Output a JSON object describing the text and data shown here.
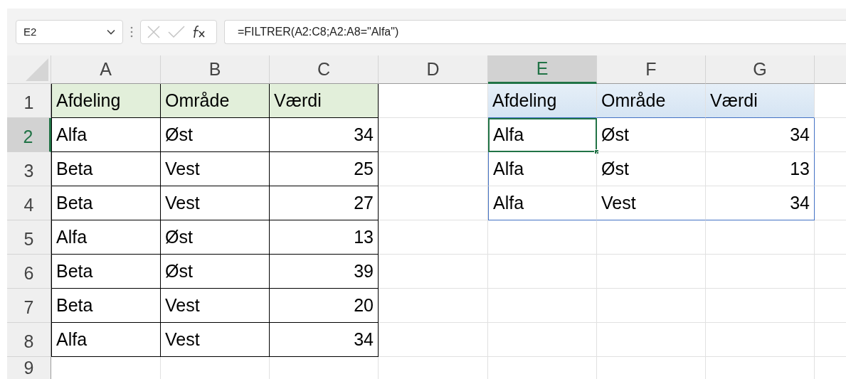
{
  "name_box": "E2",
  "formula": "=FILTRER(A2:C8;A2:A8=\"Alfa\")",
  "column_headers": [
    {
      "label": "A",
      "selected": false
    },
    {
      "label": "B",
      "selected": false
    },
    {
      "label": "C",
      "selected": false
    },
    {
      "label": "D",
      "selected": false
    },
    {
      "label": "E",
      "selected": true
    },
    {
      "label": "F",
      "selected": false
    },
    {
      "label": "G",
      "selected": false
    }
  ],
  "row_headers": [
    {
      "label": "1",
      "selected": false
    },
    {
      "label": "2",
      "selected": true
    },
    {
      "label": "3",
      "selected": false
    },
    {
      "label": "4",
      "selected": false
    },
    {
      "label": "5",
      "selected": false
    },
    {
      "label": "6",
      "selected": false
    },
    {
      "label": "7",
      "selected": false
    },
    {
      "label": "8",
      "selected": false
    },
    {
      "label": "9",
      "selected": false
    }
  ],
  "source_table": {
    "header": [
      {
        "text": "Afdeling",
        "kind": "text"
      },
      {
        "text": "Område",
        "kind": "text"
      },
      {
        "text": "Værdi",
        "kind": "number"
      }
    ],
    "rows": [
      [
        "Alfa",
        "Øst",
        "34"
      ],
      [
        "Beta",
        "Vest",
        "25"
      ],
      [
        "Beta",
        "Vest",
        "27"
      ],
      [
        "Alfa",
        "Øst",
        "13"
      ],
      [
        "Beta",
        "Øst",
        "39"
      ],
      [
        "Beta",
        "Vest",
        "20"
      ],
      [
        "Alfa",
        "Vest",
        "34"
      ]
    ]
  },
  "spill_table": {
    "header": [
      {
        "text": "Afdeling",
        "kind": "text"
      },
      {
        "text": "Område",
        "kind": "text"
      },
      {
        "text": "Værdi",
        "kind": "number"
      }
    ],
    "rows": [
      [
        {
          "text": "Alfa",
          "selected": true
        },
        {
          "text": "Øst",
          "selected": false
        },
        {
          "text": "34",
          "selected": false
        }
      ],
      [
        {
          "text": "Alfa",
          "selected": false
        },
        {
          "text": "Øst",
          "selected": false
        },
        {
          "text": "13",
          "selected": false
        }
      ],
      [
        {
          "text": "Alfa",
          "selected": false
        },
        {
          "text": "Vest",
          "selected": false
        },
        {
          "text": "34",
          "selected": false
        }
      ]
    ]
  }
}
